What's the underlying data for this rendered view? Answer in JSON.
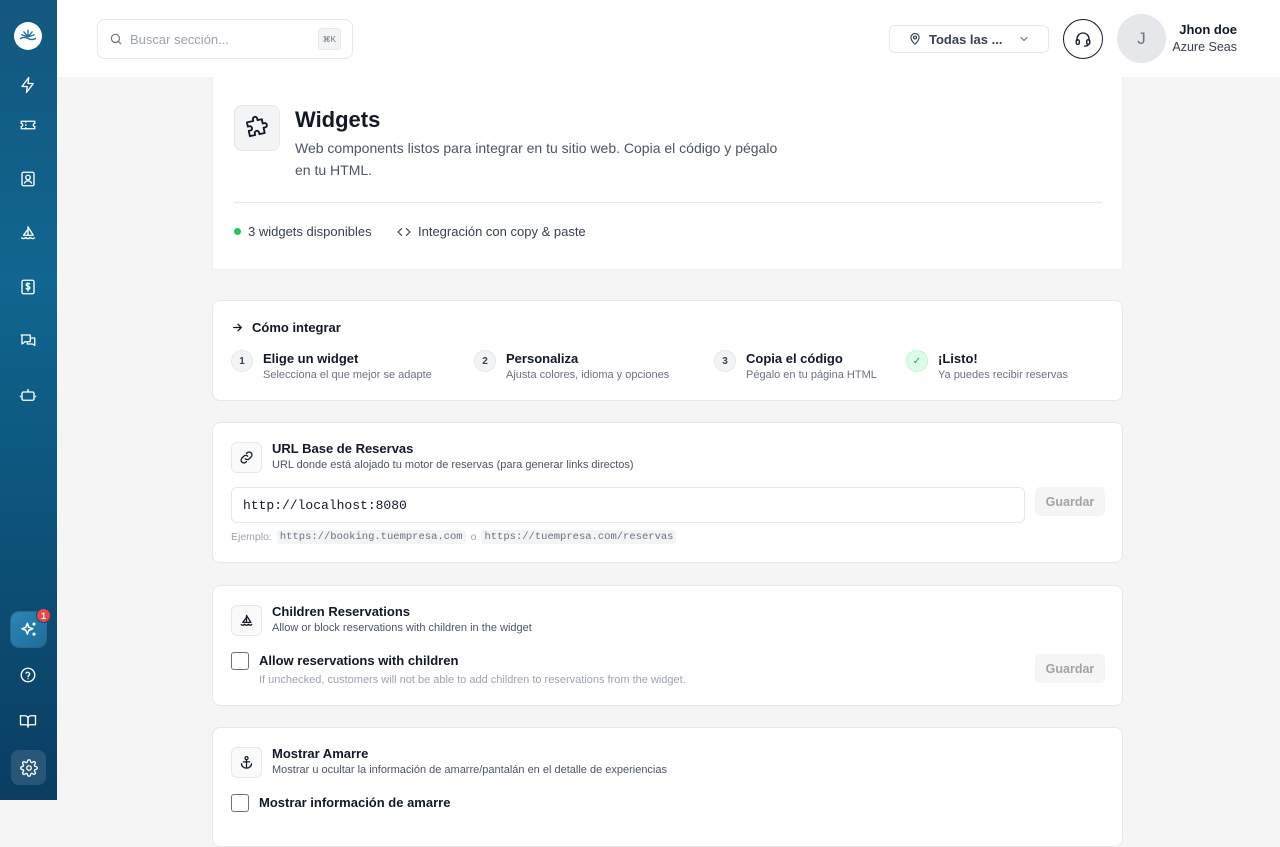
{
  "search": {
    "placeholder": "Buscar sección...",
    "shortcut": "⌘K"
  },
  "location": {
    "label": "Todas las ..."
  },
  "user": {
    "initial": "J",
    "name": "Jhon doe",
    "company": "Azure Seas"
  },
  "sidebar": {
    "ai_badge": "1"
  },
  "hero": {
    "title": "Widgets",
    "description": "Web components listos para integrar en tu sitio web. Copia el código y pégalo en tu HTML.",
    "stat_widgets": "3 widgets disponibles",
    "stat_integration": "Integración con copy & paste"
  },
  "how": {
    "title": "Cómo integrar",
    "steps": [
      {
        "num": "1",
        "title": "Elige un widget",
        "sub": "Selecciona el que mejor se adapte"
      },
      {
        "num": "2",
        "title": "Personaliza",
        "sub": "Ajusta colores, idioma y opciones"
      },
      {
        "num": "3",
        "title": "Copia el código",
        "sub": "Pégalo en tu página HTML"
      },
      {
        "num": "✓",
        "title": "¡Listo!",
        "sub": "Ya puedes recibir reservas"
      }
    ]
  },
  "url_section": {
    "title": "URL Base de Reservas",
    "subtitle": "URL donde está alojado tu motor de reservas (para generar links directos)",
    "value": "http://localhost:8080",
    "example_label": "Ejemplo:",
    "example_1": "https://booking.tuempresa.com",
    "example_or": "o",
    "example_2": "https://tuempresa.com/reservas",
    "save_label": "Guardar"
  },
  "children_section": {
    "title": "Children Reservations",
    "subtitle": "Allow or block reservations with children in the widget",
    "checkbox_label": "Allow reservations with children",
    "checkbox_help": "If unchecked, customers will not be able to add children to reservations from the widget.",
    "save_label": "Guardar"
  },
  "mooring_section": {
    "title": "Mostrar Amarre",
    "subtitle": "Mostrar u ocultar la información de amarre/pantalán en el detalle de experiencias",
    "checkbox_label": "Mostrar información de amarre"
  }
}
